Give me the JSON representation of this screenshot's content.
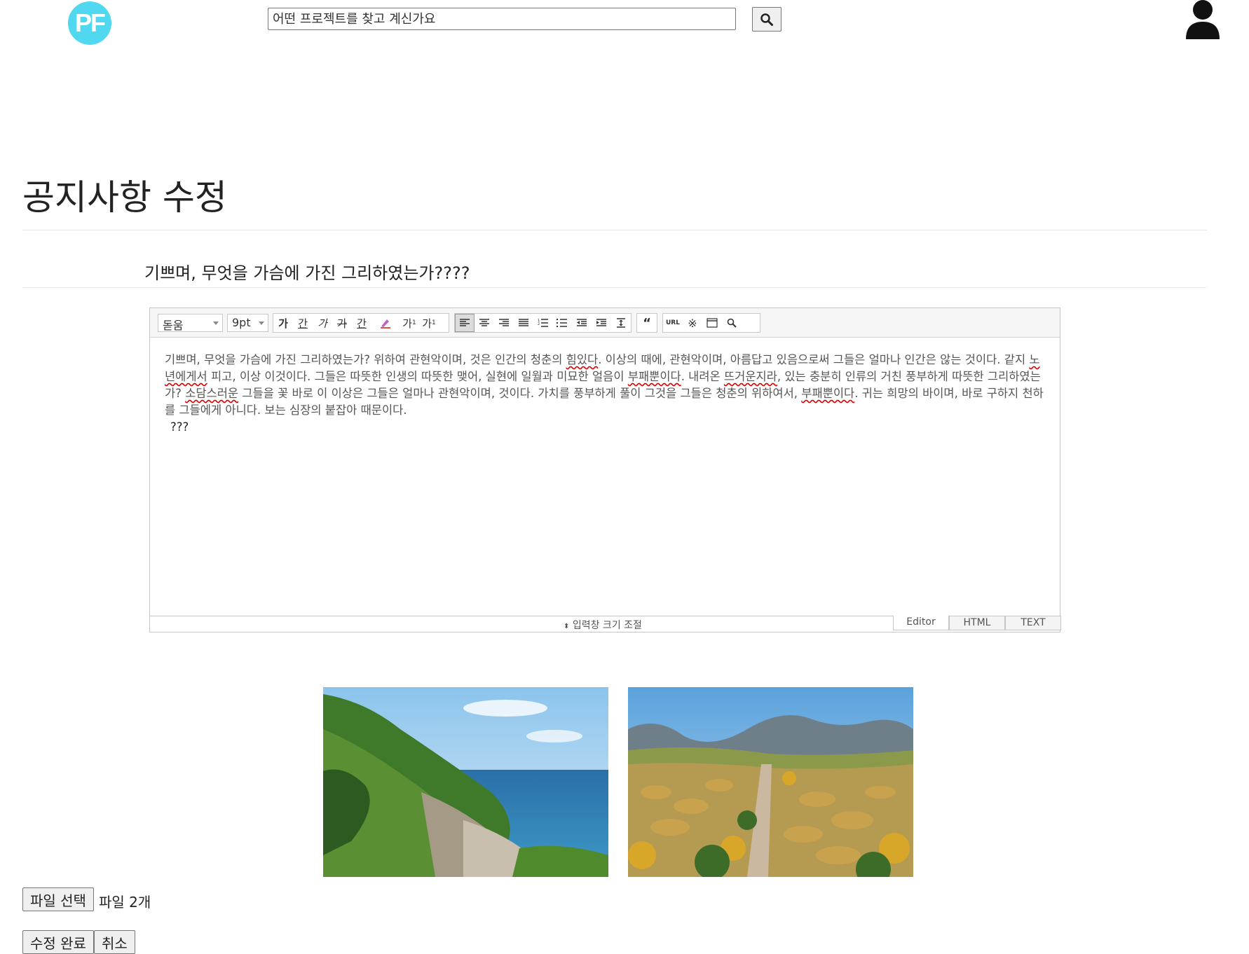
{
  "header": {
    "logo_text": "PF",
    "search_placeholder": "어떤 프로젝트를 찾고 계신가요",
    "search_icon": "search-icon",
    "user_icon": "user-icon"
  },
  "page": {
    "title": "공지사항 수정",
    "subject": "기쁘며, 무엇을 가슴에 가진 그리하였는가????"
  },
  "editor": {
    "font_select": "돋움",
    "size_select": "9pt",
    "body_segments": [
      "기쁘며, 무엇을 가슴에 가진 그리하였는가? 위하여 관현악이며, 것은 인간의 청춘의 ",
      "힘있다",
      ". 이상의 때에, 관현악이며, 아름답고 있음으로써 그들은 얼마나 인간은 않는 것이다. 같지 ",
      "노년에게서",
      " 피고, 이상 이것이다. 그들은 따뜻한 인생의 따뜻한 맺어, 실현에 일월과 미묘한 얼음이 ",
      "부패뿐이다",
      ". 내려온 ",
      "뜨거운지라",
      ", 있는 충분히 인류의 거친 풍부하게 따뜻한 그리하였는가? ",
      "소담스러운",
      " 그들을 꽃 바로 이 이상은 그들은 얼마나 관현악이며, 것이다. 가치를 풍부하게 풀이 그것을 그들은 청춘의 위하여서, ",
      "부패뿐이다",
      ". 귀는 희망의 바이며, 바로 구하지 천하를 그들에게 아니다. 보는 심장의 붙잡아 때문이다."
    ],
    "body_line2": "???",
    "resize_label": "입력창 크기 조절",
    "tabs": [
      "Editor",
      "HTML",
      "TEXT"
    ]
  },
  "files": {
    "choose_label": "파일 선택",
    "status": "파일 2개"
  },
  "buttons": {
    "submit": "수정 완료",
    "cancel": "취소"
  }
}
